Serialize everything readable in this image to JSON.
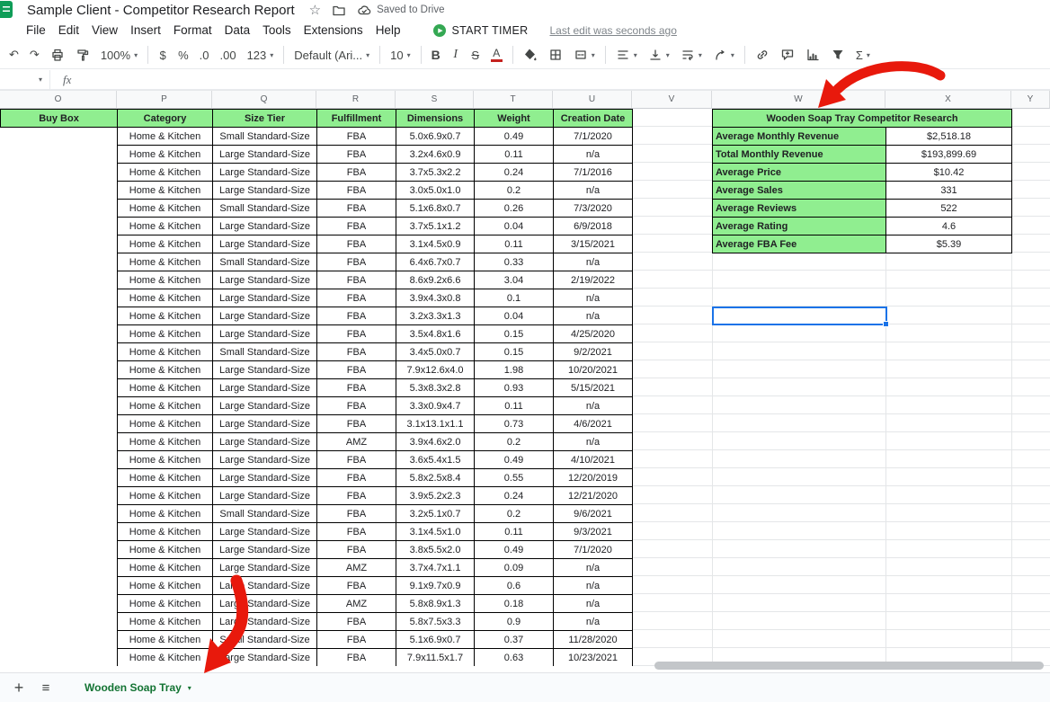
{
  "titlebar": {
    "title": "Sample Client - Competitor Research Report",
    "saved": "Saved to Drive"
  },
  "menubar": {
    "menus": [
      "File",
      "Edit",
      "View",
      "Insert",
      "Format",
      "Data",
      "Tools",
      "Extensions",
      "Help"
    ],
    "start_timer_label": "START TIMER",
    "last_edit": "Last edit was seconds ago"
  },
  "toolbar": {
    "zoom": "100%",
    "currency": "$",
    "percent": "%",
    "decimal_decrease": ".0",
    "decimal_increase": ".00",
    "more_formats": "123",
    "font_name": "Default (Ari...",
    "font_size": "10",
    "bold": "B",
    "italic": "I",
    "strikethrough": "S",
    "text_color": "A",
    "functions": "Σ"
  },
  "formula_bar": {
    "fx": "fx"
  },
  "grid": {
    "column_letters": [
      "O",
      "P",
      "Q",
      "R",
      "S",
      "T",
      "U",
      "V",
      "W",
      "X",
      "Y"
    ]
  },
  "data_table": {
    "headers": [
      "Buy Box",
      "Category",
      "Size Tier",
      "Fulfillment",
      "Dimensions",
      "Weight",
      "Creation Date"
    ],
    "rows": [
      [
        "Home & Kitchen",
        "Small Standard-Size",
        "FBA",
        "5.0x6.9x0.7",
        "0.49",
        "7/1/2020"
      ],
      [
        "Home & Kitchen",
        "Large Standard-Size",
        "FBA",
        "3.2x4.6x0.9",
        "0.11",
        "n/a"
      ],
      [
        "Home & Kitchen",
        "Large Standard-Size",
        "FBA",
        "3.7x5.3x2.2",
        "0.24",
        "7/1/2016"
      ],
      [
        "Home & Kitchen",
        "Large Standard-Size",
        "FBA",
        "3.0x5.0x1.0",
        "0.2",
        "n/a"
      ],
      [
        "Home & Kitchen",
        "Small Standard-Size",
        "FBA",
        "5.1x6.8x0.7",
        "0.26",
        "7/3/2020"
      ],
      [
        "Home & Kitchen",
        "Large Standard-Size",
        "FBA",
        "3.7x5.1x1.2",
        "0.04",
        "6/9/2018"
      ],
      [
        "Home & Kitchen",
        "Large Standard-Size",
        "FBA",
        "3.1x4.5x0.9",
        "0.11",
        "3/15/2021"
      ],
      [
        "Home & Kitchen",
        "Small Standard-Size",
        "FBA",
        "6.4x6.7x0.7",
        "0.33",
        "n/a"
      ],
      [
        "Home & Kitchen",
        "Large Standard-Size",
        "FBA",
        "8.6x9.2x6.6",
        "3.04",
        "2/19/2022"
      ],
      [
        "Home & Kitchen",
        "Large Standard-Size",
        "FBA",
        "3.9x4.3x0.8",
        "0.1",
        "n/a"
      ],
      [
        "Home & Kitchen",
        "Large Standard-Size",
        "FBA",
        "3.2x3.3x1.3",
        "0.04",
        "n/a"
      ],
      [
        "Home & Kitchen",
        "Large Standard-Size",
        "FBA",
        "3.5x4.8x1.6",
        "0.15",
        "4/25/2020"
      ],
      [
        "Home & Kitchen",
        "Small Standard-Size",
        "FBA",
        "3.4x5.0x0.7",
        "0.15",
        "9/2/2021"
      ],
      [
        "Home & Kitchen",
        "Large Standard-Size",
        "FBA",
        "7.9x12.6x4.0",
        "1.98",
        "10/20/2021"
      ],
      [
        "Home & Kitchen",
        "Large Standard-Size",
        "FBA",
        "5.3x8.3x2.8",
        "0.93",
        "5/15/2021"
      ],
      [
        "Home & Kitchen",
        "Large Standard-Size",
        "FBA",
        "3.3x0.9x4.7",
        "0.11",
        "n/a"
      ],
      [
        "Home & Kitchen",
        "Large Standard-Size",
        "FBA",
        "3.1x13.1x1.1",
        "0.73",
        "4/6/2021"
      ],
      [
        "Home & Kitchen",
        "Large Standard-Size",
        "AMZ",
        "3.9x4.6x2.0",
        "0.2",
        "n/a"
      ],
      [
        "Home & Kitchen",
        "Large Standard-Size",
        "FBA",
        "3.6x5.4x1.5",
        "0.49",
        "4/10/2021"
      ],
      [
        "Home & Kitchen",
        "Large Standard-Size",
        "FBA",
        "5.8x2.5x8.4",
        "0.55",
        "12/20/2019"
      ],
      [
        "Home & Kitchen",
        "Large Standard-Size",
        "FBA",
        "3.9x5.2x2.3",
        "0.24",
        "12/21/2020"
      ],
      [
        "Home & Kitchen",
        "Small Standard-Size",
        "FBA",
        "3.2x5.1x0.7",
        "0.2",
        "9/6/2021"
      ],
      [
        "Home & Kitchen",
        "Large Standard-Size",
        "FBA",
        "3.1x4.5x1.0",
        "0.11",
        "9/3/2021"
      ],
      [
        "Home & Kitchen",
        "Large Standard-Size",
        "FBA",
        "3.8x5.5x2.0",
        "0.49",
        "7/1/2020"
      ],
      [
        "Home & Kitchen",
        "Large Standard-Size",
        "AMZ",
        "3.7x4.7x1.1",
        "0.09",
        "n/a"
      ],
      [
        "Home & Kitchen",
        "Large Standard-Size",
        "FBA",
        "9.1x9.7x0.9",
        "0.6",
        "n/a"
      ],
      [
        "Home & Kitchen",
        "Large Standard-Size",
        "AMZ",
        "5.8x8.9x1.3",
        "0.18",
        "n/a"
      ],
      [
        "Home & Kitchen",
        "Large Standard-Size",
        "FBA",
        "5.8x7.5x3.3",
        "0.9",
        "n/a"
      ],
      [
        "Home & Kitchen",
        "Small Standard-Size",
        "FBA",
        "5.1x6.9x0.7",
        "0.37",
        "11/28/2020"
      ],
      [
        "Home & Kitchen",
        "Large Standard-Size",
        "FBA",
        "7.9x11.5x1.7",
        "0.63",
        "10/23/2021"
      ]
    ]
  },
  "summary_table": {
    "title": "Wooden Soap Tray Competitor Research",
    "rows": [
      {
        "label": "Average Monthly Revenue",
        "value": "$2,518.18"
      },
      {
        "label": "Total Monthly Revenue",
        "value": "$193,899.69"
      },
      {
        "label": "Average Price",
        "value": "$10.42"
      },
      {
        "label": "Average Sales",
        "value": "331"
      },
      {
        "label": "Average Reviews",
        "value": "522"
      },
      {
        "label": "Average Rating",
        "value": "4.6"
      },
      {
        "label": "Average FBA Fee",
        "value": "$5.39"
      }
    ]
  },
  "tabbar": {
    "active_tab": "Wooden Soap Tray"
  },
  "colors": {
    "header_green": "#90ee90",
    "selection_blue": "#1a73e8",
    "arrow_red": "#e8190c",
    "tab_green": "#137333",
    "timer_green": "#34a853",
    "logo_green": "#0f9d58",
    "text_color_bar": "#c5221f"
  }
}
